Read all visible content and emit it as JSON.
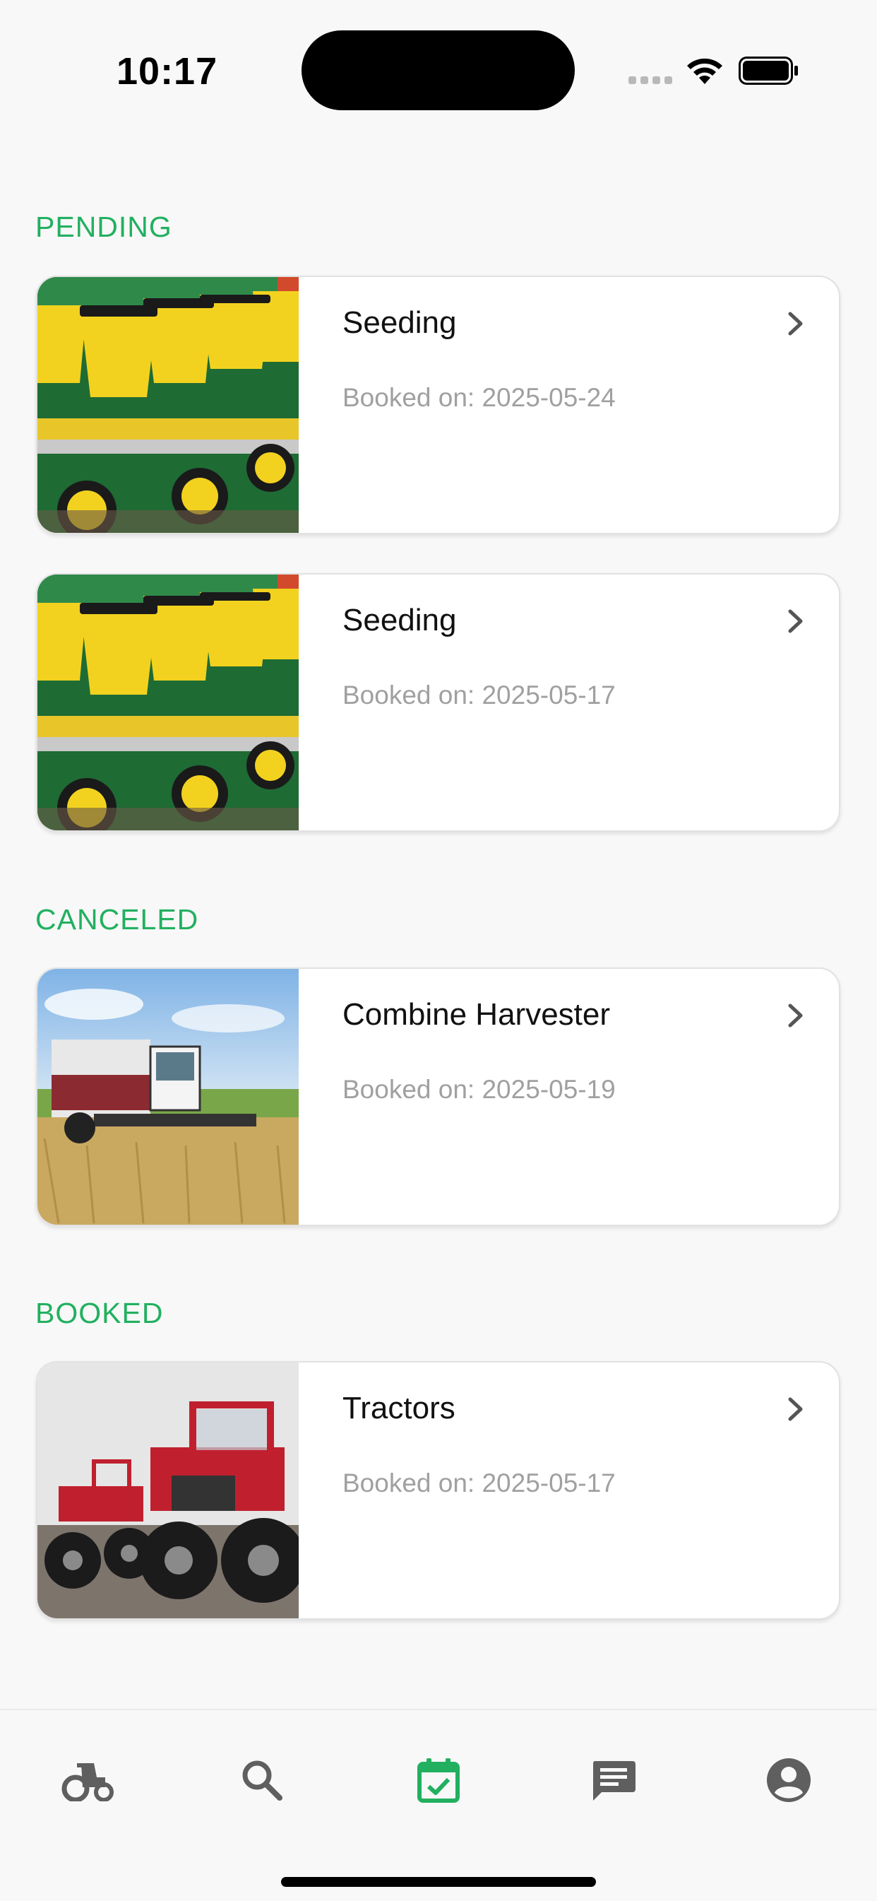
{
  "status_bar": {
    "time": "10:17"
  },
  "sections": [
    {
      "title": "PENDING",
      "cards": [
        {
          "title": "Seeding",
          "subtitle": "Booked on: 2025-05-24",
          "image": "seeding-machine-photo"
        },
        {
          "title": "Seeding",
          "subtitle": "Booked on: 2025-05-17",
          "image": "seeding-machine-photo"
        }
      ]
    },
    {
      "title": "CANCELED",
      "cards": [
        {
          "title": "Combine Harvester",
          "subtitle": "Booked on: 2025-05-19",
          "image": "combine-harvester-photo"
        }
      ]
    },
    {
      "title": "BOOKED",
      "cards": [
        {
          "title": "Tractors",
          "subtitle": "Booked on: 2025-05-17",
          "image": "tractors-photo"
        }
      ]
    }
  ],
  "tab_bar": {
    "tabs": [
      {
        "icon": "tractor-icon",
        "active": false
      },
      {
        "icon": "search-icon",
        "active": false
      },
      {
        "icon": "calendar-check-icon",
        "active": true
      },
      {
        "icon": "chat-icon",
        "active": false
      },
      {
        "icon": "account-icon",
        "active": false
      }
    ]
  },
  "colors": {
    "accent": "#22b060",
    "inactive_icon": "#5f5f5f",
    "subtitle": "#a0a0a0"
  }
}
